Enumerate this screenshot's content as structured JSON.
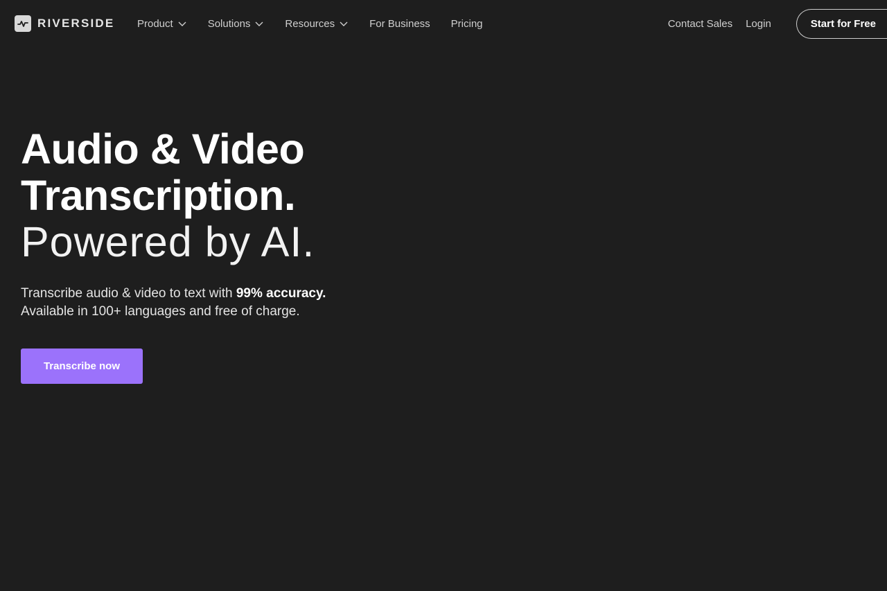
{
  "header": {
    "brand": "RIVERSIDE",
    "nav": [
      {
        "label": "Product",
        "dropdown": true
      },
      {
        "label": "Solutions",
        "dropdown": true
      },
      {
        "label": "Resources",
        "dropdown": true
      },
      {
        "label": "For Business",
        "dropdown": false
      },
      {
        "label": "Pricing",
        "dropdown": false
      }
    ],
    "contact_sales": "Contact Sales",
    "login": "Login",
    "start_free": "Start for Free"
  },
  "hero": {
    "title_line1": "Audio & Video",
    "title_line2": "Transcription.",
    "title_line3": "Powered by AI.",
    "sub_part1": "Transcribe audio & video to text with ",
    "sub_bold": "99% accuracy.",
    "sub_line2": "Available in 100+ languages and free of charge.",
    "cta_label": "Transcribe now"
  },
  "colors": {
    "background": "#1e1e1e",
    "accent": "#9b72fb",
    "text": "#ffffff"
  },
  "icons": {
    "logo": "waveform-logo-icon",
    "dropdown": "chevron-down-icon"
  }
}
